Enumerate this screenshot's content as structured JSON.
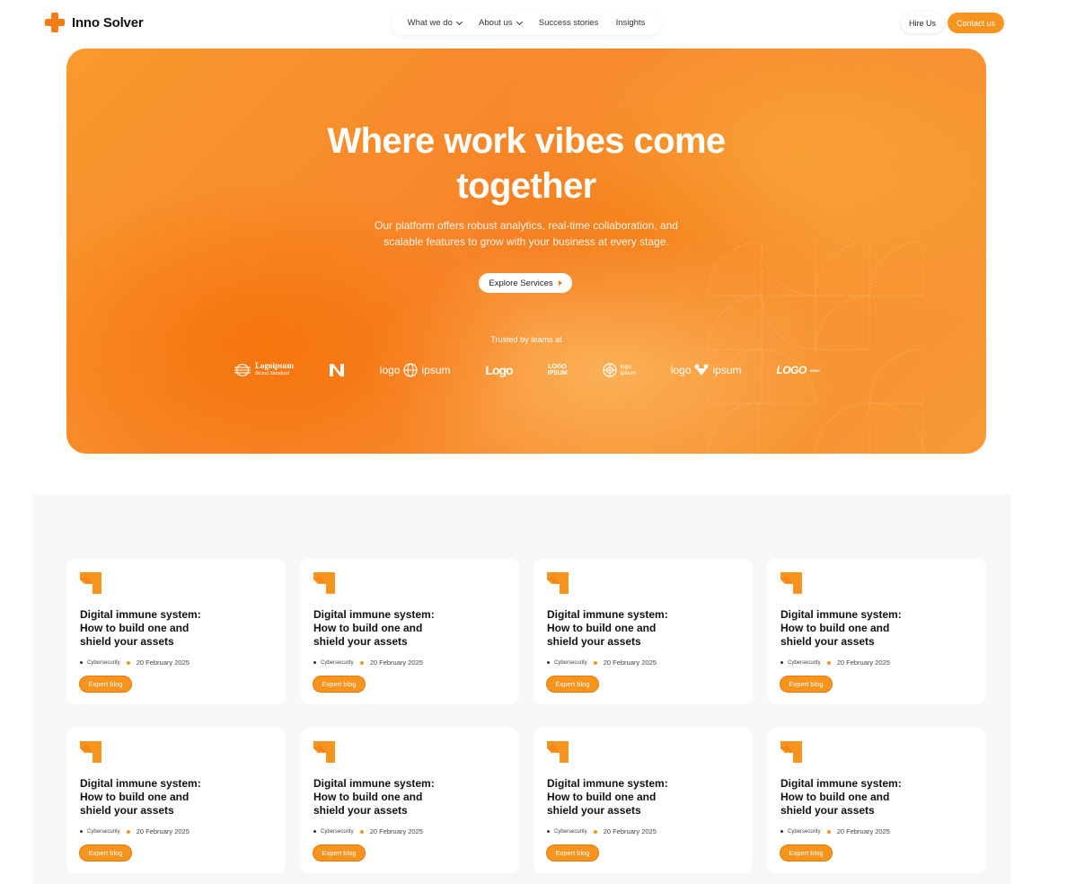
{
  "brand": {
    "name": "Inno Solver"
  },
  "nav": {
    "items": [
      {
        "label": "What we do",
        "has_dropdown": true
      },
      {
        "label": "About us",
        "has_dropdown": true
      },
      {
        "label": "Success stories",
        "has_dropdown": false
      },
      {
        "label": "Insights",
        "has_dropdown": false
      }
    ],
    "hire_label": "Hire Us",
    "contact_label": "Contact us"
  },
  "hero": {
    "title_line1": "Where work vibes come",
    "title_line2": "together",
    "subtitle_line1": "Our platform offers robust analytics, real-time collaboration, and",
    "subtitle_line2": "scalable features to grow with your business at every stage.",
    "cta_label": "Explore Services",
    "trusted_label": "Trusted by teams at",
    "logos": {
      "l1_name": "Logoipsum",
      "l1_tagline": "Brand Standard",
      "l2_name": "N",
      "l3_left": "logo",
      "l3_right": "ipsum",
      "l4_name": "Logo",
      "l5_top": "LOGO",
      "l5_bottom": "IPSUM",
      "l6_top": "logo",
      "l6_bottom": "ipsum",
      "l7_left": "logo",
      "l7_right": "ipsum",
      "l8_name": "LOGO",
      "l8_sub": "IPSUM"
    }
  },
  "colors": {
    "accent": "#f7941d",
    "accent_dark": "#f47c15",
    "section_bg": "#f7f7f7"
  },
  "blog": {
    "cards": [
      {
        "title_line1": "Digital immune system:",
        "title_line2": "How to build one and",
        "title_line3": "shield your assets",
        "category": "Cybersecurity",
        "date": "20 February 2025",
        "tag": "Expert blog",
        "icon": "arrow-tile-icon"
      },
      {
        "title_line1": "Digital immune system:",
        "title_line2": "How to build one and",
        "title_line3": "shield your assets",
        "category": "Cybersecurity",
        "date": "20 February 2025",
        "tag": "Expert blog",
        "icon": "arrow-tile-icon"
      },
      {
        "title_line1": "Digital immune system:",
        "title_line2": "How to build one and",
        "title_line3": "shield your assets",
        "category": "Cybersecurity",
        "date": "20 February 2025",
        "tag": "Expert blog",
        "icon": "arrow-tile-icon"
      },
      {
        "title_line1": "Digital immune system:",
        "title_line2": "How to build one and",
        "title_line3": "shield your assets",
        "category": "Cybersecurity",
        "date": "20 February 2025",
        "tag": "Expert blog",
        "icon": "arrow-tile-icon"
      },
      {
        "title_line1": "Digital immune system:",
        "title_line2": "How to build one and",
        "title_line3": "shield your assets",
        "category": "Cybersecurity",
        "date": "20 February 2025",
        "tag": "Expert blog",
        "icon": "arrow-tile-icon"
      },
      {
        "title_line1": "Digital immune system:",
        "title_line2": "How to build one and",
        "title_line3": "shield your assets",
        "category": "Cybersecurity",
        "date": "20 February 2025",
        "tag": "Expert blog",
        "icon": "arrow-tile-icon"
      },
      {
        "title_line1": "Digital immune system:",
        "title_line2": "How to build one and",
        "title_line3": "shield your assets",
        "category": "Cybersecurity",
        "date": "20 February 2025",
        "tag": "Expert blog",
        "icon": "arrow-tile-icon"
      },
      {
        "title_line1": "Digital immune system:",
        "title_line2": "How to build one and",
        "title_line3": "shield your assets",
        "category": "Cybersecurity",
        "date": "20 February 2025",
        "tag": "Expert blog",
        "icon": "arrow-tile-icon"
      }
    ]
  }
}
